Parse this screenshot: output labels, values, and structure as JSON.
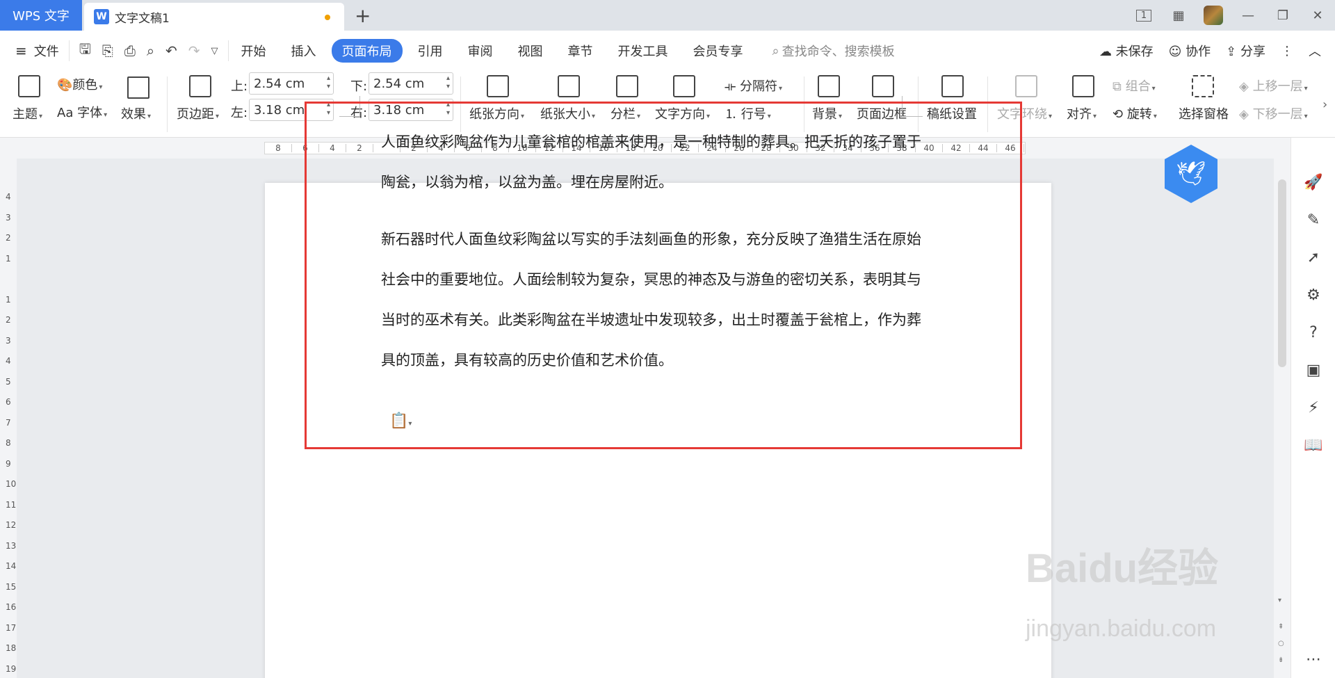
{
  "titlebar": {
    "app_name": "WPS 文字",
    "doc_name": "文字文稿1",
    "new_tab": "+",
    "page_indicator": "1"
  },
  "menu": {
    "file": "文件",
    "items": [
      "开始",
      "插入",
      "页面布局",
      "引用",
      "审阅",
      "视图",
      "章节",
      "开发工具",
      "会员专享"
    ],
    "active": "页面布局",
    "search_placeholder": "查找命令、搜索模板",
    "unsaved": "未保存",
    "collaborate": "协作",
    "share": "分享"
  },
  "ribbon": {
    "theme": "主题",
    "color": "颜色",
    "font": "字体",
    "effect": "效果",
    "margins": "页边距",
    "top_label": "上:",
    "top_value": "2.54 cm",
    "bottom_label": "下:",
    "bottom_value": "2.54 cm",
    "left_label": "左:",
    "left_value": "3.18 cm",
    "right_label": "右:",
    "right_value": "3.18 cm",
    "orientation": "纸张方向",
    "size": "纸张大小",
    "columns": "分栏",
    "text_direction": "文字方向",
    "breaks": "分隔符",
    "line_numbers": "行号",
    "background": "背景",
    "page_border": "页面边框",
    "paper_settings": "稿纸设置",
    "text_wrap": "文字环绕",
    "align": "对齐",
    "group": "组合",
    "rotate": "旋转",
    "selection_pane": "选择窗格",
    "bring_forward": "上移一层",
    "send_backward": "下移一层"
  },
  "ruler": {
    "labels": [
      "8",
      "6",
      "4",
      "2",
      "",
      "2",
      "4",
      "6",
      "8",
      "10",
      "12",
      "14",
      "16",
      "18",
      "20",
      "22",
      "24",
      "26",
      "28",
      "30",
      "32",
      "34",
      "36",
      "38",
      "40",
      "42",
      "44",
      "46"
    ]
  },
  "vruler": {
    "labels": [
      "4",
      "3",
      "2",
      "1",
      "",
      "1",
      "2",
      "3",
      "4",
      "5",
      "6",
      "7",
      "8",
      "9",
      "10",
      "11",
      "12",
      "13",
      "14",
      "15",
      "16",
      "17",
      "18",
      "19"
    ]
  },
  "document": {
    "paragraph1": "人面鱼纹彩陶盆作为儿童瓮棺的棺盖来使用，是一种特制的葬具。把夭折的孩子置于陶瓮，以翁为棺，以盆为盖。埋在房屋附近。",
    "paragraph2": "新石器时代人面鱼纹彩陶盆以写实的手法刻画鱼的形象，充分反映了渔猎生活在原始社会中的重要地位。人面绘制较为复杂，冥思的神态及与游鱼的密切关系，表明其与当时的巫术有关。此类彩陶盆在半坡遗址中发现较多，出土时覆盖于瓮棺上，作为葬具的顶盖，具有较高的历史价值和艺术价值。"
  },
  "watermark": {
    "brand": "Baidu经验",
    "url": "jingyan.baidu.com"
  },
  "colors": {
    "accent": "#3b7be9",
    "highlight_border": "#e53935",
    "unsaved_dot": "#f0a000"
  }
}
